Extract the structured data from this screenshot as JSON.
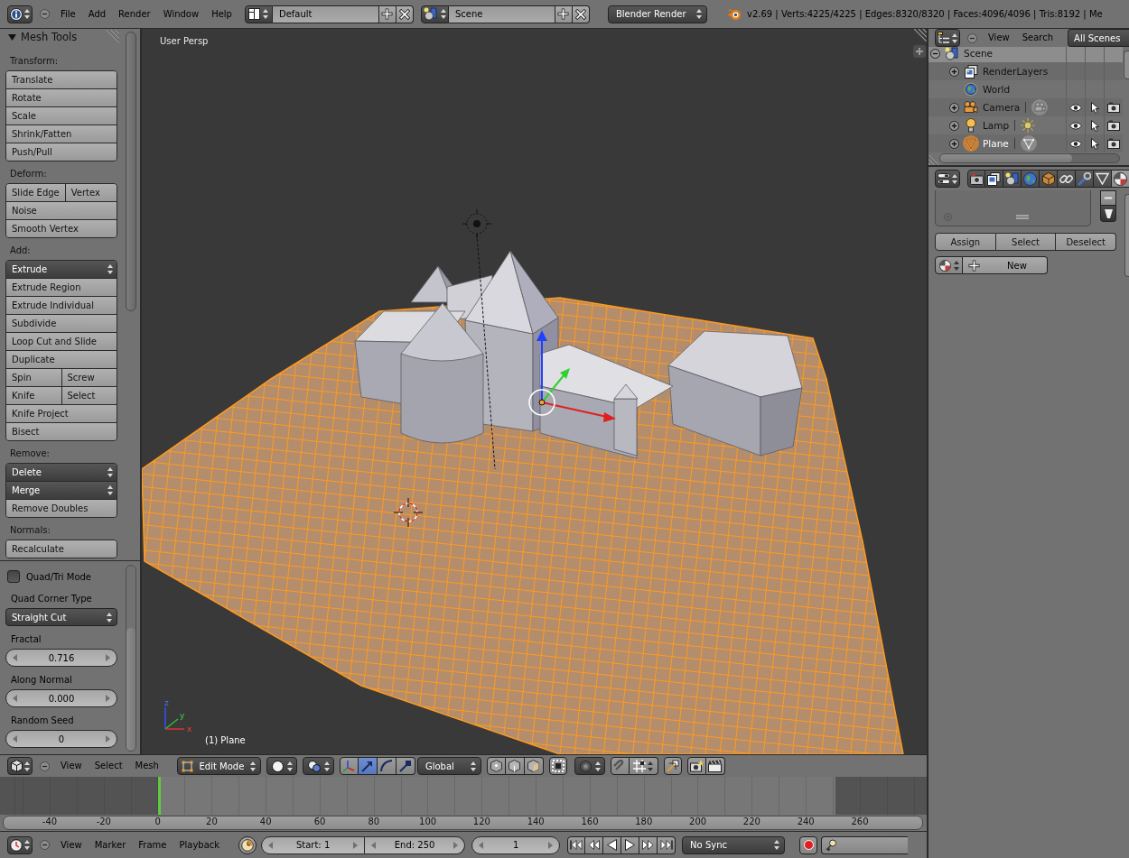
{
  "info_header": {
    "menus": [
      "File",
      "Add",
      "Render",
      "Window",
      "Help"
    ],
    "screen_layout": "Default",
    "scene": "Scene",
    "render_engine": "Blender Render",
    "stats": "v2.69 | Verts:4225/4225 | Edges:8320/8320 | Faces:4096/4096 | Tris:8192 | Me"
  },
  "tool_shelf": {
    "title": "Mesh Tools",
    "expanded": true,
    "sections": [
      {
        "label": "Transform:",
        "rows": [
          [
            {
              "label": "Translate",
              "kind": "button"
            }
          ],
          [
            {
              "label": "Rotate",
              "kind": "button"
            }
          ],
          [
            {
              "label": "Scale",
              "kind": "button"
            }
          ],
          [
            {
              "label": "Shrink/Fatten",
              "kind": "button"
            }
          ],
          [
            {
              "label": "Push/Pull",
              "kind": "button"
            }
          ]
        ]
      },
      {
        "label": "Deform:",
        "rows": [
          [
            {
              "label": "Slide Edge",
              "kind": "button"
            },
            {
              "label": "Vertex",
              "kind": "button"
            }
          ],
          [
            {
              "label": "Noise",
              "kind": "button"
            }
          ],
          [
            {
              "label": "Smooth Vertex",
              "kind": "button"
            }
          ]
        ]
      },
      {
        "label": "Add:",
        "rows": [
          [
            {
              "label": "Extrude",
              "kind": "menu"
            }
          ],
          [
            {
              "label": "Extrude Region",
              "kind": "button"
            }
          ],
          [
            {
              "label": "Extrude Individual",
              "kind": "button"
            }
          ],
          [
            {
              "label": "Subdivide",
              "kind": "button"
            }
          ],
          [
            {
              "label": "Loop Cut and Slide",
              "kind": "button"
            }
          ],
          [
            {
              "label": "Duplicate",
              "kind": "button"
            }
          ],
          [
            {
              "label": "Spin",
              "kind": "button"
            },
            {
              "label": "Screw",
              "kind": "button"
            }
          ],
          [
            {
              "label": "Knife",
              "kind": "button"
            },
            {
              "label": "Select",
              "kind": "button"
            }
          ],
          [
            {
              "label": "Knife Project",
              "kind": "button"
            }
          ],
          [
            {
              "label": "Bisect",
              "kind": "button"
            }
          ]
        ]
      },
      {
        "label": "Remove:",
        "rows": [
          [
            {
              "label": "Delete",
              "kind": "menu"
            }
          ],
          [
            {
              "label": "Merge",
              "kind": "menu"
            }
          ],
          [
            {
              "label": "Remove Doubles",
              "kind": "button"
            }
          ]
        ]
      },
      {
        "label": "Normals:",
        "rows": [
          [
            {
              "label": "Recalculate",
              "kind": "button"
            }
          ]
        ]
      }
    ]
  },
  "operator_panel": {
    "quad_tri_mode": {
      "label": "Quad/Tri Mode",
      "checked": false
    },
    "corner_type": {
      "label": "Quad Corner Type",
      "value": "Straight Cut"
    },
    "fields": [
      {
        "label": "Fractal",
        "value": "0.716"
      },
      {
        "label": "Along Normal",
        "value": "0.000"
      },
      {
        "label": "Random Seed",
        "value": "0"
      }
    ]
  },
  "viewport": {
    "view_name": "User Persp",
    "axis_labels": [
      "z",
      "y",
      "x"
    ],
    "object_info": "(1) Plane"
  },
  "view3d_header": {
    "menus": [
      "View",
      "Select",
      "Mesh"
    ],
    "mode": "Edit Mode",
    "manipulators": [
      {
        "kind": "axes",
        "selected": false
      },
      {
        "kind": "translate",
        "selected": true
      },
      {
        "kind": "rotate",
        "selected": false
      },
      {
        "kind": "scale",
        "selected": false
      }
    ],
    "orientation": "Global"
  },
  "timeline": {
    "ruler_labels": [
      "-40",
      "-20",
      "0",
      "20",
      "40",
      "60",
      "80",
      "100",
      "120",
      "140",
      "160",
      "180",
      "200",
      "220",
      "240",
      "260"
    ],
    "menus": [
      "View",
      "Marker",
      "Frame",
      "Playback"
    ],
    "start": "Start: 1",
    "end": "End: 250",
    "current_frame": "1",
    "sync": "No Sync"
  },
  "outliner": {
    "menus": [
      "View",
      "Search"
    ],
    "filter": "All Scenes",
    "tree": [
      {
        "name": "Scene",
        "kind": "scene",
        "expanded": true,
        "selected": false,
        "children": [
          {
            "name": "RenderLayers",
            "kind": "render_layers",
            "expanded": false,
            "selected": false
          },
          {
            "name": "World",
            "kind": "world",
            "selected": false
          },
          {
            "name": "Camera",
            "kind": "camera",
            "expanded": false,
            "selected": false,
            "visible": true,
            "selectable": true,
            "renderable": true
          },
          {
            "name": "Lamp",
            "kind": "lamp",
            "expanded": false,
            "selected": false,
            "visible": true,
            "selectable": true,
            "renderable": true
          },
          {
            "name": "Plane",
            "kind": "mesh",
            "expanded": false,
            "selected": true,
            "visible": true,
            "selectable": true,
            "renderable": true
          }
        ]
      }
    ]
  },
  "properties": {
    "tabs": [
      {
        "kind": "render",
        "selected": false
      },
      {
        "kind": "render_layers",
        "selected": false
      },
      {
        "kind": "scene",
        "selected": false
      },
      {
        "kind": "world",
        "selected": false
      },
      {
        "kind": "object",
        "selected": false
      },
      {
        "kind": "constraints",
        "selected": false
      },
      {
        "kind": "modifiers",
        "selected": false
      },
      {
        "kind": "data",
        "selected": false
      },
      {
        "kind": "material",
        "selected": true
      }
    ],
    "slot_buttons": [
      "Assign",
      "Select",
      "Deselect"
    ],
    "new_button": "New"
  }
}
